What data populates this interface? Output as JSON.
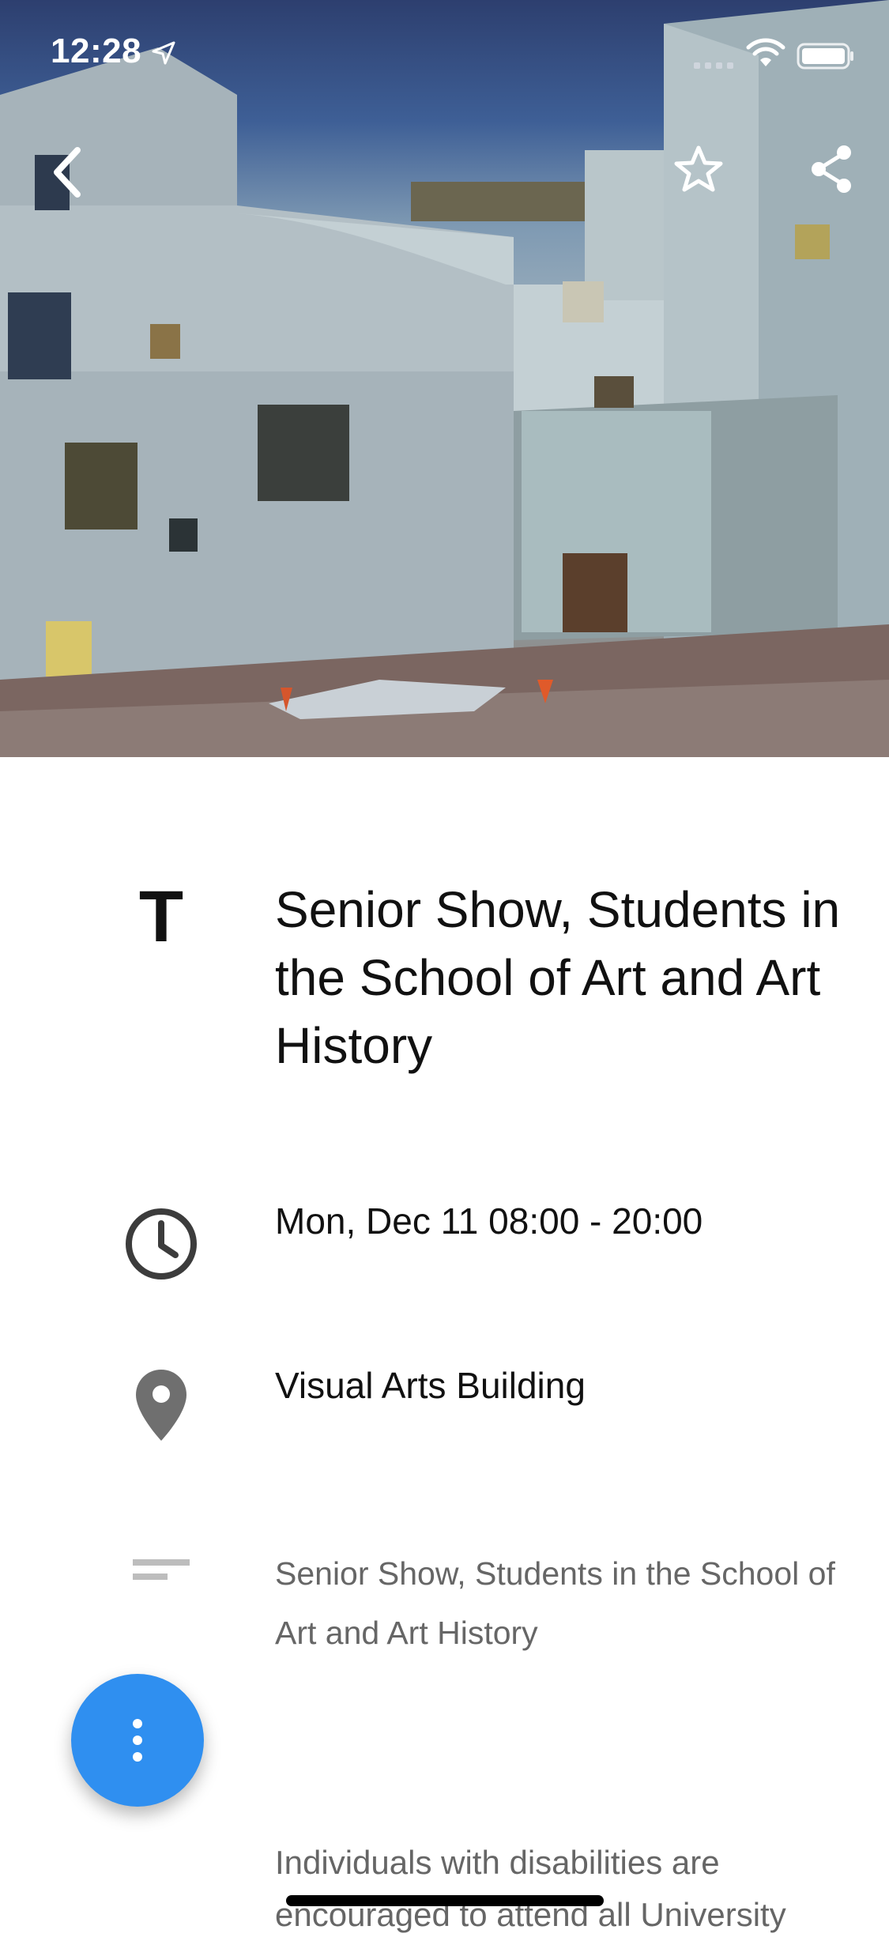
{
  "status_bar": {
    "time": "12:28",
    "icons": [
      "location-arrow-icon",
      "signal-icon",
      "wifi-icon",
      "battery-icon"
    ]
  },
  "header": {
    "image": "building-photo",
    "actions": [
      "back-icon",
      "star-icon",
      "share-icon"
    ]
  },
  "event": {
    "title_icon": "T",
    "title": "Senior Show, Students in the School of Art and Art History",
    "datetime": "Mon, Dec 11 08:00 - 20:00",
    "location": "Visual Arts Building",
    "description": "Senior Show, Students in the School of Art and Art History",
    "disability_note": "Individuals with disabilities are encouraged to attend all University"
  },
  "fab": {
    "icon": "more-vertical-icon"
  },
  "colors": {
    "accent": "#2f8ff0",
    "text_primary": "#111111",
    "text_secondary": "#666666"
  }
}
